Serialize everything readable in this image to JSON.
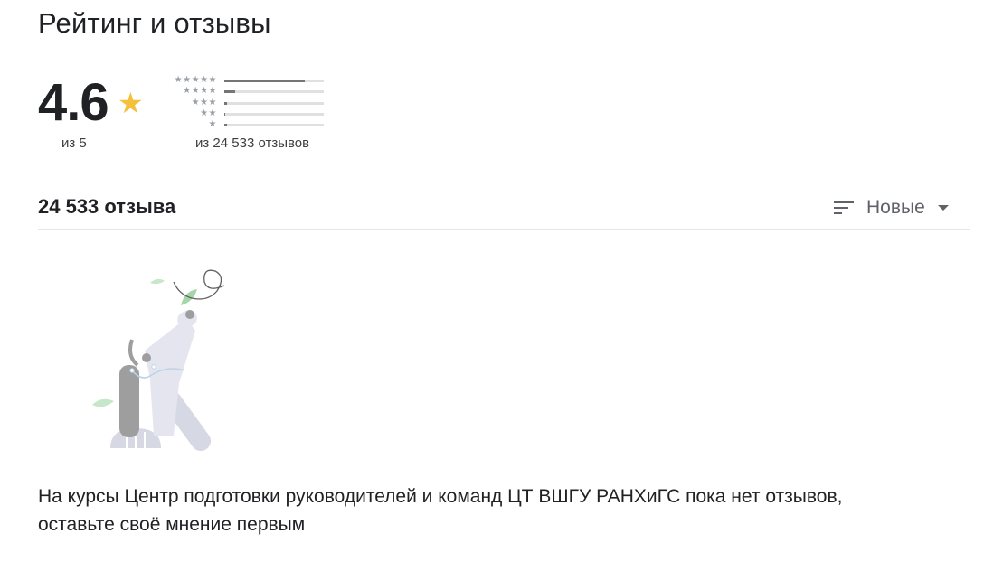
{
  "section": {
    "title": "Рейтинг и отзывы"
  },
  "rating": {
    "score": "4.6",
    "star_glyph": "★",
    "out_of": "из 5",
    "total_caption": "из 24 533 отзывов",
    "distribution": [
      {
        "stars": "★★★★★",
        "fraction": 0.81
      },
      {
        "stars": "★★★★",
        "fraction": 0.11
      },
      {
        "stars": "★★★",
        "fraction": 0.03
      },
      {
        "stars": "★★",
        "fraction": 0.01
      },
      {
        "stars": "★",
        "fraction": 0.03
      }
    ]
  },
  "reviews": {
    "count_label": "24 533 отзыва",
    "sort_label": "Новые",
    "empty_message": "На курсы Центр подготовки руководителей и команд ЦТ ВШГУ РАНХиГС пока нет отзывов, оставьте своё мнение первым"
  },
  "icons": {
    "sort": "sort-lines-icon",
    "dropdown": "caret-down-icon",
    "rating_star": "star-icon"
  },
  "colors": {
    "star": "#f4c13d",
    "bar_fill": "#757575",
    "bar_track": "#e0e0e0",
    "muted_text": "#5f6368"
  }
}
